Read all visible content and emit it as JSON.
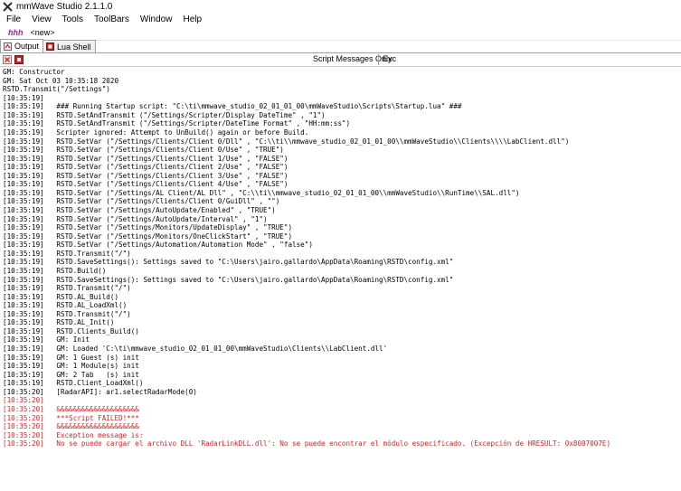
{
  "window": {
    "title": "mmWave Studio 2.1.1.0"
  },
  "menu": [
    "File",
    "View",
    "Tools",
    "ToolBars",
    "Window",
    "Help"
  ],
  "toolbar": {
    "logo": "hhh",
    "new_label": "<new>"
  },
  "tabs": [
    {
      "label": "Output",
      "active": true
    },
    {
      "label": "Lua Shell",
      "active": false
    }
  ],
  "subbar": {
    "filter_label": "Script Messages Only",
    "exc_label": "Exc"
  },
  "colors": {
    "error": "#e02020",
    "logo": "#a020a0",
    "accent": "#d02020"
  },
  "output_lines": [
    {
      "text": "GM: Constructor",
      "error": false
    },
    {
      "text": "GM: Sat Oct 03 10:35:18 2020",
      "error": false
    },
    {
      "text": "RSTD.Transmit(\"/Settings\")",
      "error": false
    },
    {
      "text": "[10:35:19]",
      "error": false
    },
    {
      "text": "[10:35:19]   ### Running Startup script: \"C:\\ti\\mmwave_studio_02_01_01_00\\mmWaveStudio\\Scripts\\Startup.lua\" ###",
      "error": false
    },
    {
      "text": "[10:35:19]   RSTD.SetAndTransmit (\"/Settings/Scripter/Display DateTime\" , \"1\")",
      "error": false
    },
    {
      "text": "[10:35:19]   RSTD.SetAndTransmit (\"/Settings/Scripter/DateTime Format\" , \"HH:mm:ss\")",
      "error": false
    },
    {
      "text": "[10:35:19]   Scripter ignored: Attempt to UnBuild() again or before Build.",
      "error": false
    },
    {
      "text": "[10:35:19]   RSTD.SetVar (\"/Settings/Clients/Client 0/Dll\" , \"C:\\\\ti\\\\mmwave_studio_02_01_01_00\\\\mmWaveStudio\\\\Clients\\\\\\\\LabClient.dll\")",
      "error": false
    },
    {
      "text": "[10:35:19]   RSTD.SetVar (\"/Settings/Clients/Client 0/Use\" , \"TRUE\")",
      "error": false
    },
    {
      "text": "[10:35:19]   RSTD.SetVar (\"/Settings/Clients/Client 1/Use\" , \"FALSE\")",
      "error": false
    },
    {
      "text": "[10:35:19]   RSTD.SetVar (\"/Settings/Clients/Client 2/Use\" , \"FALSE\")",
      "error": false
    },
    {
      "text": "[10:35:19]   RSTD.SetVar (\"/Settings/Clients/Client 3/Use\" , \"FALSE\")",
      "error": false
    },
    {
      "text": "[10:35:19]   RSTD.SetVar (\"/Settings/Clients/Client 4/Use\" , \"FALSE\")",
      "error": false
    },
    {
      "text": "[10:35:19]   RSTD.SetVar (\"/Settings/AL Client/AL Dll\" , \"C:\\\\ti\\\\mmwave_studio_02_01_01_00\\\\mmWaveStudio\\\\RunTime\\\\SAL.dll\")",
      "error": false
    },
    {
      "text": "[10:35:19]   RSTD.SetVar (\"/Settings/Clients/Client 0/GuiDll\" , \"\")",
      "error": false
    },
    {
      "text": "[10:35:19]   RSTD.SetVar (\"/Settings/AutoUpdate/Enabled\" , \"TRUE\")",
      "error": false
    },
    {
      "text": "[10:35:19]   RSTD.SetVar (\"/Settings/AutoUpdate/Interval\" , \"1\")",
      "error": false
    },
    {
      "text": "[10:35:19]   RSTD.SetVar (\"/Settings/Monitors/UpdateDisplay\" , \"TRUE\")",
      "error": false
    },
    {
      "text": "[10:35:19]   RSTD.SetVar (\"/Settings/Monitors/OneClickStart\" , \"TRUE\")",
      "error": false
    },
    {
      "text": "[10:35:19]   RSTD.SetVar (\"/Settings/Automation/Automation Mode\" , \"false\")",
      "error": false
    },
    {
      "text": "[10:35:19]   RSTD.Transmit(\"/\")",
      "error": false
    },
    {
      "text": "[10:35:19]   RSTD.SaveSettings(): Settings saved to \"C:\\Users\\jairo.gallardo\\AppData\\Roaming\\RSTD\\config.xml\"",
      "error": false
    },
    {
      "text": "[10:35:19]   RSTD.Build()",
      "error": false
    },
    {
      "text": "[10:35:19]   RSTD.SaveSettings(): Settings saved to \"C:\\Users\\jairo.gallardo\\AppData\\Roaming\\RSTD\\config.xml\"",
      "error": false
    },
    {
      "text": "[10:35:19]   RSTD.Transmit(\"/\")",
      "error": false
    },
    {
      "text": "[10:35:19]   RSTD.AL_Build()",
      "error": false
    },
    {
      "text": "[10:35:19]   RSTD.AL_LoadXml()",
      "error": false
    },
    {
      "text": "[10:35:19]   RSTD.Transmit(\"/\")",
      "error": false
    },
    {
      "text": "[10:35:19]   RSTD.AL_Init()",
      "error": false
    },
    {
      "text": "[10:35:19]   RSTD.Clients_Build()",
      "error": false
    },
    {
      "text": "[10:35:19]   GM: Init",
      "error": false
    },
    {
      "text": "[10:35:19]   GM: Loaded 'C:\\ti\\mmwave_studio_02_01_01_00\\mmWaveStudio\\Clients\\\\LabClient.dll'",
      "error": false
    },
    {
      "text": "[10:35:19]   GM: 1 Guest (s) init",
      "error": false
    },
    {
      "text": "[10:35:19]   GM: 1 Module(s) init",
      "error": false
    },
    {
      "text": "[10:35:19]   GM: 2 Tab   (s) init",
      "error": false
    },
    {
      "text": "[10:35:19]   RSTD.Client_LoadXml()",
      "error": false
    },
    {
      "text": "[10:35:20]   [RadarAPI]: ar1.selectRadarMode(0)",
      "error": false
    },
    {
      "text": "[10:35:20]",
      "error": true
    },
    {
      "text": "[10:35:20]   &&&&&&&&&&&&&&&&&&&&",
      "error": true
    },
    {
      "text": "[10:35:20]   ***Script FAILED!***",
      "error": true
    },
    {
      "text": "[10:35:20]   &&&&&&&&&&&&&&&&&&&&",
      "error": true
    },
    {
      "text": "[10:35:20]   Exception message is:",
      "error": true
    },
    {
      "text": "[10:35:20]   No se puede cargar el archivo DLL 'RadarLinkDLL.dll': No se puede encontrar el módulo especificado. (Excepción de HRESULT: 0x8007007E)",
      "error": true
    }
  ]
}
